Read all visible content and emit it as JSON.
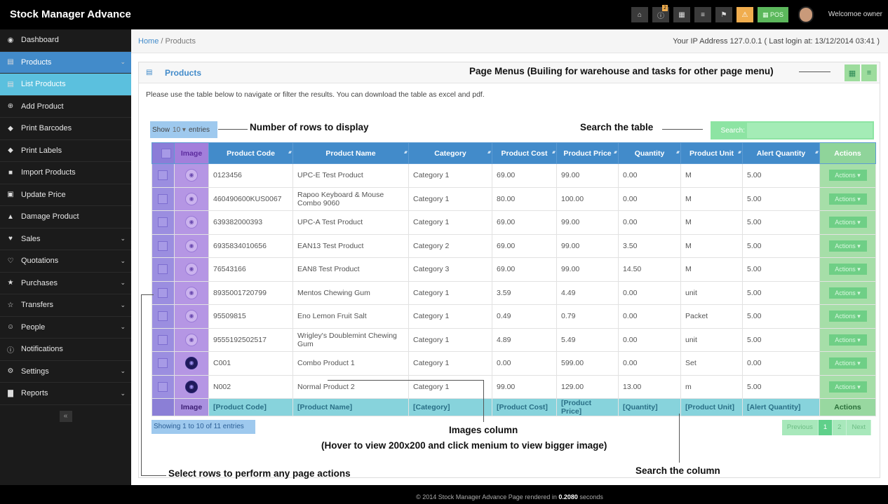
{
  "app": {
    "brand": "Stock Manager Advance",
    "welcome": "Welcomoe owner"
  },
  "topbar": {
    "icons": [
      {
        "name": "home-icon",
        "glyph": "⌂"
      },
      {
        "name": "info-icon",
        "glyph": "ⓘ",
        "badge": "2"
      },
      {
        "name": "calendar-icon",
        "glyph": "▦"
      },
      {
        "name": "language-icon",
        "glyph": "≡"
      },
      {
        "name": "notification-icon",
        "glyph": "⚑"
      },
      {
        "name": "warning-icon",
        "glyph": "⚠"
      }
    ],
    "pos_label": "POS"
  },
  "sidebar": {
    "items": [
      {
        "label": "Dashboard",
        "icon": "dashboard-icon",
        "glyph": "◉",
        "state": ""
      },
      {
        "label": "Products",
        "icon": "products-icon",
        "glyph": "▤",
        "state": "active",
        "chev": "⌄"
      },
      {
        "label": "List Products",
        "icon": "list-icon",
        "glyph": "▤",
        "state": "sub"
      },
      {
        "label": "Add Product",
        "icon": "plus-icon",
        "glyph": "⊕",
        "state": ""
      },
      {
        "label": "Print Barcodes",
        "icon": "tag-icon",
        "glyph": "◆",
        "state": ""
      },
      {
        "label": "Print Labels",
        "icon": "tag-icon",
        "glyph": "◆",
        "state": ""
      },
      {
        "label": "Import Products",
        "icon": "file-icon",
        "glyph": "■",
        "state": ""
      },
      {
        "label": "Update Price",
        "icon": "money-icon",
        "glyph": "▣",
        "state": ""
      },
      {
        "label": "Damage Product",
        "icon": "filter-icon",
        "glyph": "▲",
        "state": ""
      },
      {
        "label": "Sales",
        "icon": "heart-icon",
        "glyph": "♥",
        "state": "",
        "chev": "⌄"
      },
      {
        "label": "Quotations",
        "icon": "heart-outline-icon",
        "glyph": "♡",
        "state": "",
        "chev": "⌄"
      },
      {
        "label": "Purchases",
        "icon": "star-icon",
        "glyph": "★",
        "state": "",
        "chev": "⌄"
      },
      {
        "label": "Transfers",
        "icon": "star-outline-icon",
        "glyph": "☆",
        "state": "",
        "chev": "⌄"
      },
      {
        "label": "People",
        "icon": "users-icon",
        "glyph": "☺",
        "state": "",
        "chev": "⌄"
      },
      {
        "label": "Notifications",
        "icon": "info-icon",
        "glyph": "ⓘ",
        "state": ""
      },
      {
        "label": "Settings",
        "icon": "gear-icon",
        "glyph": "⚙",
        "state": "",
        "chev": "⌄"
      },
      {
        "label": "Reports",
        "icon": "bar-chart-icon",
        "glyph": "▇",
        "state": "",
        "chev": "⌄"
      }
    ],
    "collapse": "«"
  },
  "breadcrumb": {
    "home": "Home",
    "sep": "/",
    "current": "Products"
  },
  "ip_info": "Your IP Address 127.0.0.1 ( Last login at: 13/12/2014 03:41 )",
  "box": {
    "title": "Products",
    "intro": "Please use the table below to navigate or filter the results. You can download the table as excel and pdf."
  },
  "controls": {
    "show": "Show",
    "length": "10",
    "entries": "entries",
    "search_label": "Search:",
    "search_value": ""
  },
  "annotations": {
    "page_menus": "Page Menus (Builing for warehouse and tasks for other page menu)",
    "rows": "Number of rows to display",
    "search_table": "Search the table",
    "images_col": "Images column",
    "images_hint": "(Hover to view 200x200 and click menium to view bigger image)",
    "select_rows": "Select rows to perform any page actions",
    "search_col": "Search the column"
  },
  "table": {
    "headers": [
      "",
      "Image",
      "Product Code",
      "Product Name",
      "Category",
      "Product Cost",
      "Product Price",
      "Quantity",
      "Product Unit",
      "Alert Quantity",
      "Actions"
    ],
    "rows": [
      {
        "code": "0123456",
        "name": "UPC-E Test Product",
        "cat": "Category 1",
        "cost": "69.00",
        "price": "99.00",
        "qty": "0.00",
        "unit": "M",
        "alert": "5.00",
        "img": "light"
      },
      {
        "code": "460490600KUS0067",
        "name": "Rapoo Keyboard & Mouse Combo 9060",
        "cat": "Category 1",
        "cost": "80.00",
        "price": "100.00",
        "qty": "0.00",
        "unit": "M",
        "alert": "5.00",
        "img": "light"
      },
      {
        "code": "639382000393",
        "name": "UPC-A Test Product",
        "cat": "Category 1",
        "cost": "69.00",
        "price": "99.00",
        "qty": "0.00",
        "unit": "M",
        "alert": "5.00",
        "img": "light"
      },
      {
        "code": "6935834010656",
        "name": "EAN13 Test Product",
        "cat": "Category 2",
        "cost": "69.00",
        "price": "99.00",
        "qty": "3.50",
        "unit": "M",
        "alert": "5.00",
        "img": "light"
      },
      {
        "code": "76543166",
        "name": "EAN8 Test Product",
        "cat": "Category 3",
        "cost": "69.00",
        "price": "99.00",
        "qty": "14.50",
        "unit": "M",
        "alert": "5.00",
        "img": "light"
      },
      {
        "code": "8935001720799",
        "name": "Mentos Chewing Gum",
        "cat": "Category 1",
        "cost": "3.59",
        "price": "4.49",
        "qty": "0.00",
        "unit": "unit",
        "alert": "5.00",
        "img": "light"
      },
      {
        "code": "95509815",
        "name": "Eno Lemon Fruit Salt",
        "cat": "Category 1",
        "cost": "0.49",
        "price": "0.79",
        "qty": "0.00",
        "unit": "Packet",
        "alert": "5.00",
        "img": "light"
      },
      {
        "code": "9555192502517",
        "name": "Wrigley's Doublemint Chewing Gum",
        "cat": "Category 1",
        "cost": "4.89",
        "price": "5.49",
        "qty": "0.00",
        "unit": "unit",
        "alert": "5.00",
        "img": "light"
      },
      {
        "code": "C001",
        "name": "Combo Product 1",
        "cat": "Category 1",
        "cost": "0.00",
        "price": "599.00",
        "qty": "0.00",
        "unit": "Set",
        "alert": "0.00",
        "img": "dark"
      },
      {
        "code": "N002",
        "name": "Normal Product 2",
        "cat": "Category 1",
        "cost": "99.00",
        "price": "129.00",
        "qty": "13.00",
        "unit": "m",
        "alert": "5.00",
        "img": "dark"
      }
    ],
    "action_label": "Actions ▾",
    "footer": [
      "",
      "Image",
      "[Product Code]",
      "[Product Name]",
      "[Category]",
      "[Product Cost]",
      "[Product Price]",
      "[Quantity]",
      "[Product Unit]",
      "[Alert Quantity]",
      "Actions"
    ]
  },
  "info": "Showing 1 to 10 of 11 entries",
  "pager": [
    "Previous",
    "1",
    "2",
    "Next"
  ],
  "footer": {
    "text": "© 2014 Stock Manager Advance Page rendered in ",
    "time": "0.2080",
    "suffix": " seconds"
  }
}
